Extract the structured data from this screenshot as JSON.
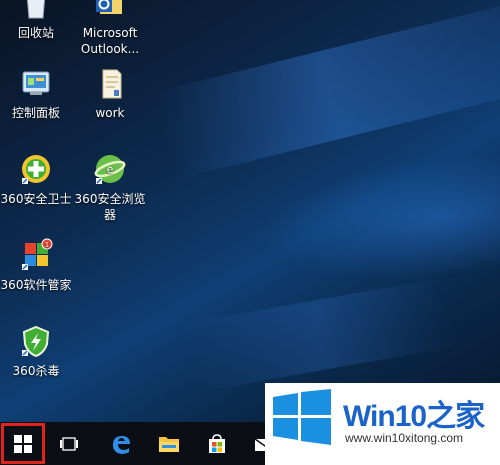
{
  "desktop": {
    "icons": [
      {
        "label": "回收站",
        "icon": "recycle-bin-icon"
      },
      {
        "label": "Microsoft Outlook...",
        "icon": "outlook-icon"
      },
      {
        "label": "控制面板",
        "icon": "control-panel-icon"
      },
      {
        "label": "work",
        "icon": "folder-icon"
      },
      {
        "label": "360安全卫士",
        "icon": "360-safe-guard-icon"
      },
      {
        "label": "360安全浏览器",
        "icon": "360-browser-icon"
      },
      {
        "label": "360软件管家",
        "icon": "360-software-manager-icon"
      },
      {
        "label": "360杀毒",
        "icon": "360-antivirus-icon"
      }
    ]
  },
  "taskbar": {
    "items": [
      "start-icon",
      "task-view-icon",
      "edge-icon",
      "file-explorer-icon",
      "store-icon",
      "mail-icon"
    ],
    "highlight_color": "#e0231d"
  },
  "watermark": {
    "title_latin": "Win10",
    "title_cjk": "之家",
    "url": "www.win10xitong.com"
  }
}
